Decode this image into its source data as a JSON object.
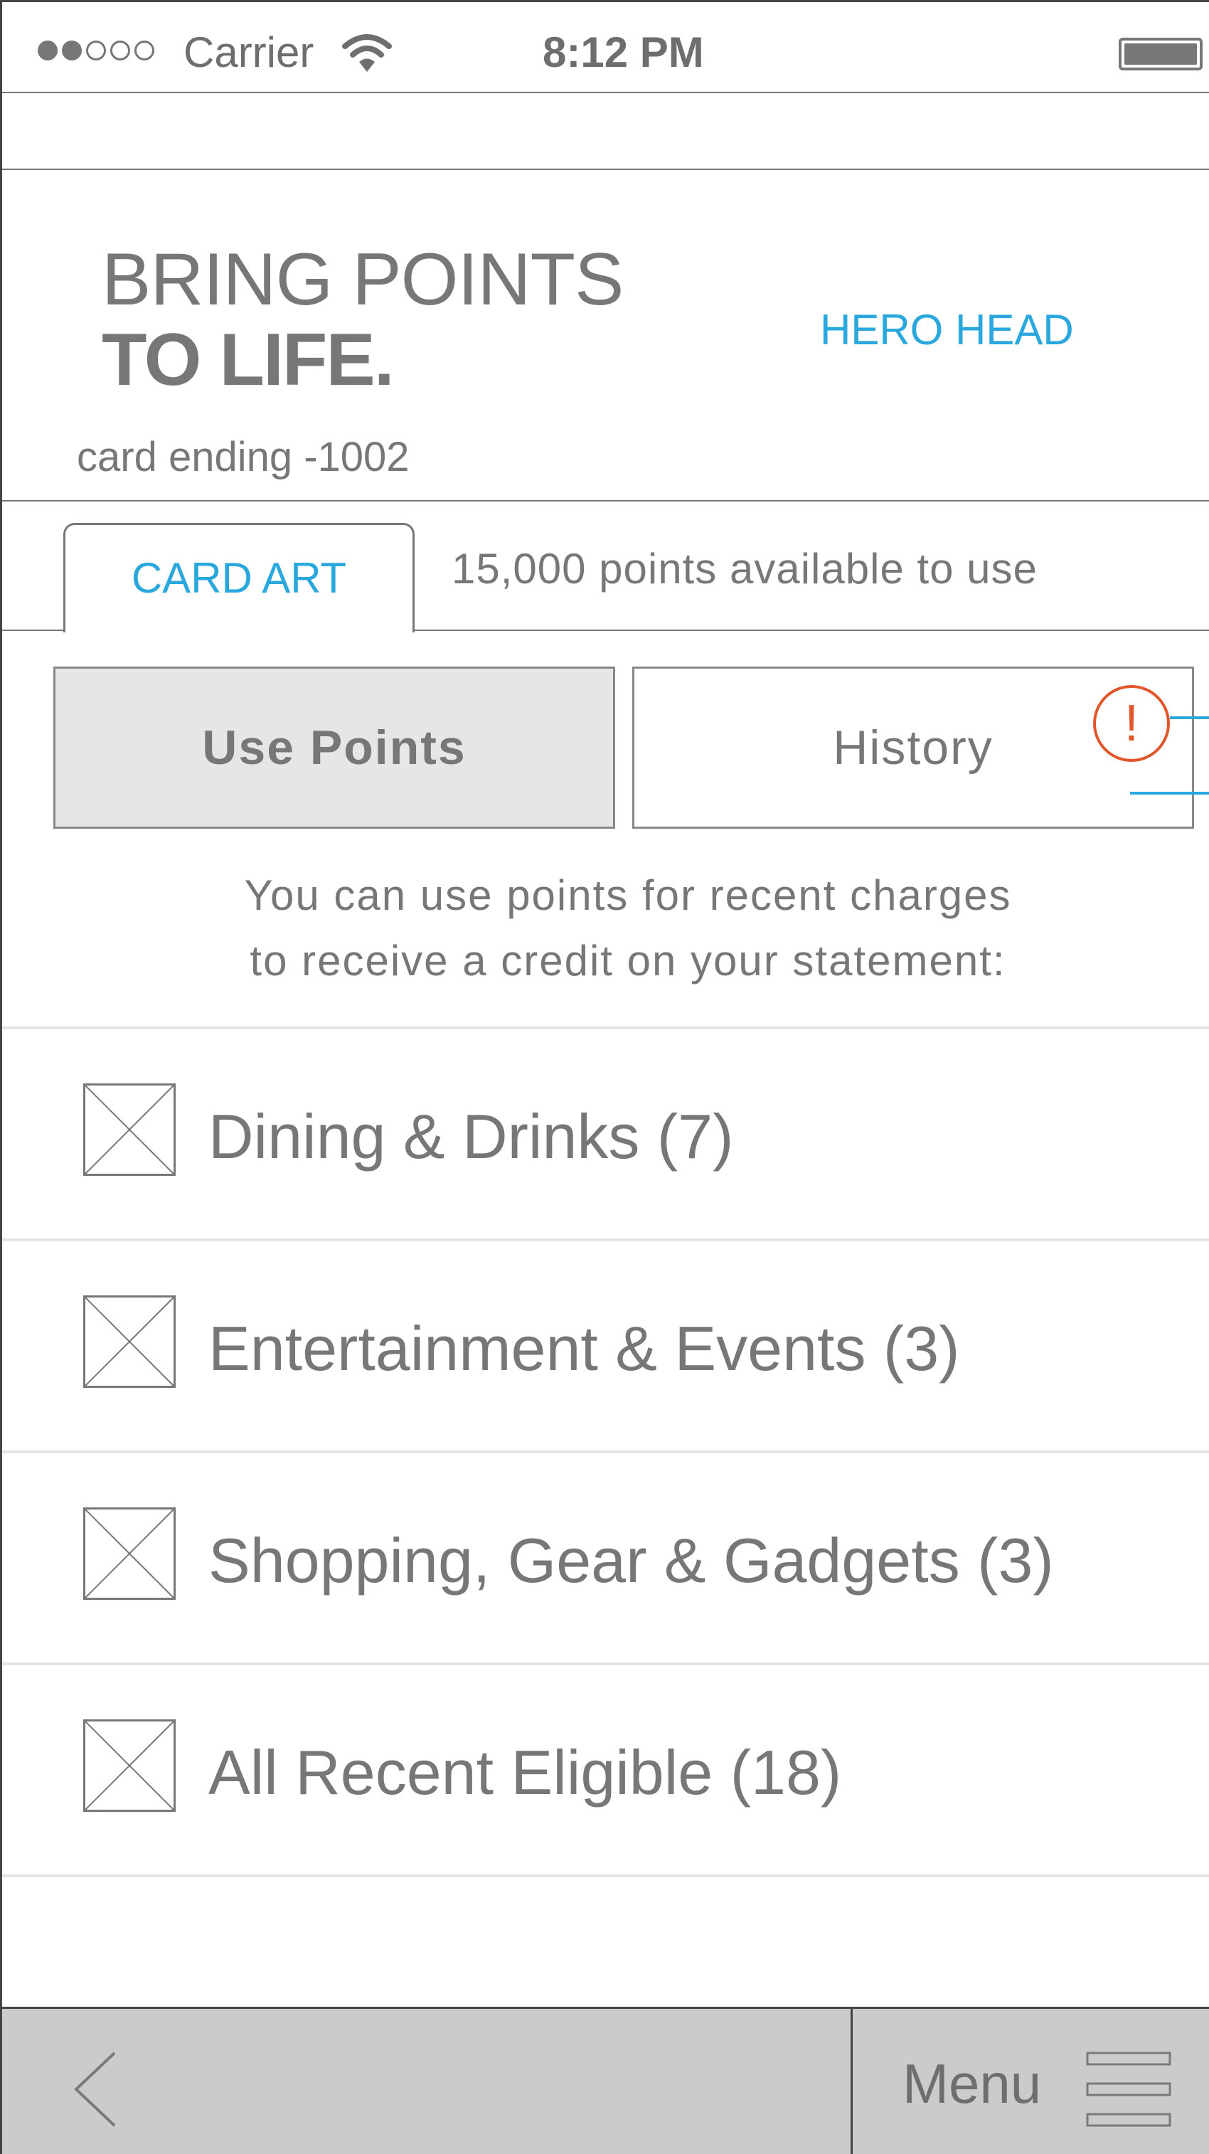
{
  "status_bar": {
    "carrier": "Carrier",
    "time": "8:12 PM",
    "signal_filled": 2,
    "signal_total": 5
  },
  "hero": {
    "title_line1": "BRING POINTS",
    "title_line2": "TO LIFE.",
    "hero_head": "HERO HEAD",
    "card_ending": "card ending -1002"
  },
  "card": {
    "card_art_label": "CARD ART",
    "points_available": "15,000 points available to use"
  },
  "segments": {
    "use_points": "Use Points",
    "history": "History",
    "alert_glyph": "!"
  },
  "description": {
    "line1": "You can use points for recent charges",
    "line2": "to receive a credit on your statement:"
  },
  "categories": [
    {
      "label": "Dining & Drinks (7)"
    },
    {
      "label": "Entertainment & Events (3)"
    },
    {
      "label": "Shopping, Gear & Gadgets (3)"
    },
    {
      "label": "All Recent Eligible (18)"
    }
  ],
  "bottom_bar": {
    "menu_label": "Menu"
  },
  "colors": {
    "accent_blue": "#2aa7dc",
    "alert_orange": "#e1572b",
    "text_gray": "#777777",
    "bar_gray": "#cbcbcb"
  }
}
